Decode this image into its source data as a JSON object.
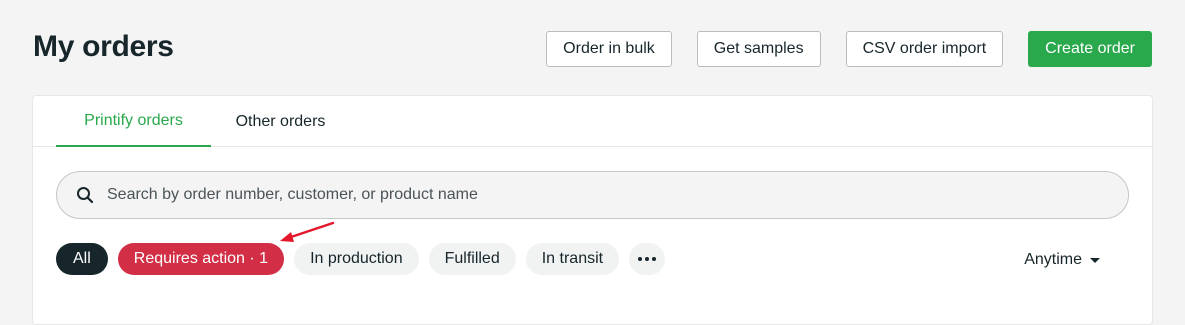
{
  "page": {
    "title": "My orders"
  },
  "header": {
    "order_in_bulk": "Order in bulk",
    "get_samples": "Get samples",
    "csv_import": "CSV order import",
    "create_order": "Create order"
  },
  "tabs": [
    {
      "label": "Printify orders",
      "active": true
    },
    {
      "label": "Other orders",
      "active": false
    }
  ],
  "search": {
    "placeholder": "Search by order number, customer, or product name",
    "value": ""
  },
  "filters": {
    "all": "All",
    "requires_action": "Requires action · 1",
    "in_production": "In production",
    "fulfilled": "Fulfilled",
    "in_transit": "In transit",
    "more_icon": "more-horizontal-icon"
  },
  "date_filter": {
    "label": "Anytime",
    "icon": "caret-down-icon"
  },
  "colors": {
    "brand_green": "#29a84c",
    "alert_red": "#d22e45",
    "dark": "#17262b",
    "annotation_arrow": "#e3172b"
  }
}
